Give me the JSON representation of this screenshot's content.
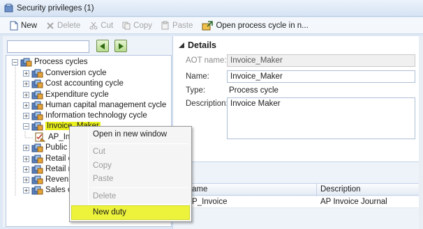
{
  "window": {
    "title": "Security privileges (1)"
  },
  "toolbar": {
    "new_label": "New",
    "delete_label": "Delete",
    "cut_label": "Cut",
    "copy_label": "Copy",
    "paste_label": "Paste",
    "open_label": "Open process cycle  in n..."
  },
  "search": {
    "value": ""
  },
  "tree": {
    "root": "Process cycles",
    "items": [
      "Conversion cycle",
      "Cost accounting cycle",
      "Expenditure cycle",
      "Human capital management cycle",
      "Information technology cycle",
      "Invoice_Maker",
      "AP_In",
      "Public se",
      "Retail cyc",
      "Retail me",
      "Revenue",
      "Sales ope"
    ]
  },
  "details": {
    "header": "Details",
    "aot_label": "AOT name:",
    "aot_value": "Invoice_Maker",
    "name_label": "Name:",
    "name_value": "Invoice_Maker",
    "type_label": "Type:",
    "type_value": "Process cycle",
    "desc_label": "Description:",
    "desc_value": "Invoice Maker"
  },
  "grid": {
    "col_name": "ame",
    "col_desc": "Description",
    "rows": [
      {
        "name": "P_Invoice",
        "desc": "AP Invoice Journal"
      }
    ]
  },
  "context_menu": {
    "open_new": "Open in new window",
    "cut": "Cut",
    "copy": "Copy",
    "paste": "Paste",
    "delete": "Delete",
    "new_duty": "New duty"
  },
  "colors": {
    "highlight": "#ecf33a",
    "tree_selection": "#e8ef1b"
  }
}
